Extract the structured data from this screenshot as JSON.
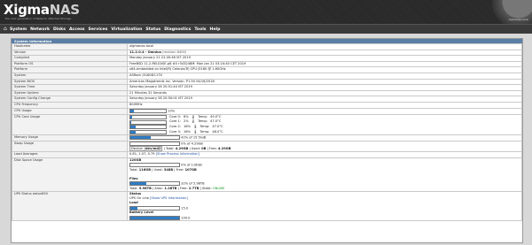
{
  "header": {
    "logo_main": "Xigma",
    "logo_accent": "NAS",
    "logo_sub": "the next generation of Network Attached Storage",
    "corner_link": "xigmanas.local"
  },
  "nav": {
    "items": [
      "System",
      "Network",
      "Disks",
      "Access",
      "Services",
      "Virtualization",
      "Status",
      "Diagnostics",
      "Tools",
      "Help"
    ]
  },
  "panel": {
    "title": "System Information",
    "rows": {
      "hostname": {
        "label": "Hostname",
        "value": "xigmanas.local"
      },
      "version": {
        "label": "Version",
        "value": "11.2.0.4 - Omnius",
        "extra": "(revision 6400)"
      },
      "compiled": {
        "label": "Compiled",
        "value": "Monday January 21 22:45:46 IST 2019"
      },
      "platform_os": {
        "label": "Platform OS",
        "value": "FreeBSD 11.2-RELEASE-p8 #0 r343248M: Mon Jan 21 03:24:40 CET 2019"
      },
      "platform": {
        "label": "Platform",
        "value": "x64-embedded on Intel(R) Celeron(R) CPU J3160 @ 1.60GHz"
      },
      "system": {
        "label": "System",
        "value": "ASRock J3160DC-ITX"
      },
      "system_bios": {
        "label": "System BIOS",
        "value": "American Megatrends Inc. Version: P1.50 04/16/2018"
      },
      "system_time": {
        "label": "System Time",
        "value": "Saturday January 26 20:51:44 IST 2019"
      },
      "system_uptime": {
        "label": "System Uptime",
        "value": "21 Minutes 31 Seconds"
      },
      "config_change": {
        "label": "System Config Change",
        "value": "Saturday January 26 20:50:01 IST 2019"
      },
      "cpu_freq": {
        "label": "CPU Frequency",
        "value": "800MHz"
      },
      "cpu_usage": {
        "label": "CPU Usage",
        "value": "10%",
        "percent": 10
      },
      "cpu_cores": {
        "label": "CPU Core Usage",
        "cores": [
          {
            "name": "Core 0:",
            "usage": "6%",
            "percent": 6,
            "temp_label": "Temp:",
            "temp": "49.0°C"
          },
          {
            "name": "Core 1:",
            "usage": "2%",
            "percent": 2,
            "temp_label": "Temp:",
            "temp": "47.0°C"
          },
          {
            "name": "Core 2:",
            "usage": "16%",
            "percent": 16,
            "temp_label": "Temp:",
            "temp": "47.0°C"
          },
          {
            "name": "Core 3:",
            "usage": "16%",
            "percent": 16,
            "temp_label": "Temp:",
            "temp": "48.0°C"
          }
        ]
      },
      "memory": {
        "label": "Memory Usage",
        "value": "42% of 15.5GiB",
        "percent": 42
      },
      "swap": {
        "label": "Swap Usage",
        "value": "0% of 4.29GB",
        "percent": 0,
        "device_label": "Device:",
        "device": "/dev/md2",
        "total_label": "Total:",
        "total": "4.29GB",
        "used_label": "Used:",
        "used": "0B",
        "free_label": "Free:",
        "free": "4.29GB"
      },
      "load": {
        "label": "Load Averages",
        "value": "0.81, 1.07, 0.79",
        "link": "[Show Process Information]"
      },
      "disk_space": {
        "label": "Disk Space Usage",
        "pools": [
          {
            "name": "120GB",
            "value": "0% of 116GB",
            "percent": 0,
            "details": [
              [
                "Total:",
                "116GB"
              ],
              [
                "Used:",
                "348B"
              ],
              [
                "Free:",
                "107GB"
              ]
            ]
          },
          {
            "name": "Files",
            "value": "32% of 5.98TB",
            "percent": 32,
            "details": [
              [
                "Total:",
                "5.98TB"
              ],
              [
                "Alloc:",
                "1.28TB"
              ],
              [
                "Free:",
                "2.7TB"
              ],
              [
                "State:",
                "ONLINE"
              ]
            ]
          }
        ]
      },
      "ups": {
        "label": "UPS Status eaton850",
        "status_title": "Status",
        "status": "UPS On Line",
        "status_link": "[Show UPS Information]",
        "load_title": "Load",
        "load_value": "15.0",
        "load_percent": 15,
        "battery_title": "Battery Level",
        "battery_value": "100.0",
        "battery_percent": 100
      }
    }
  }
}
